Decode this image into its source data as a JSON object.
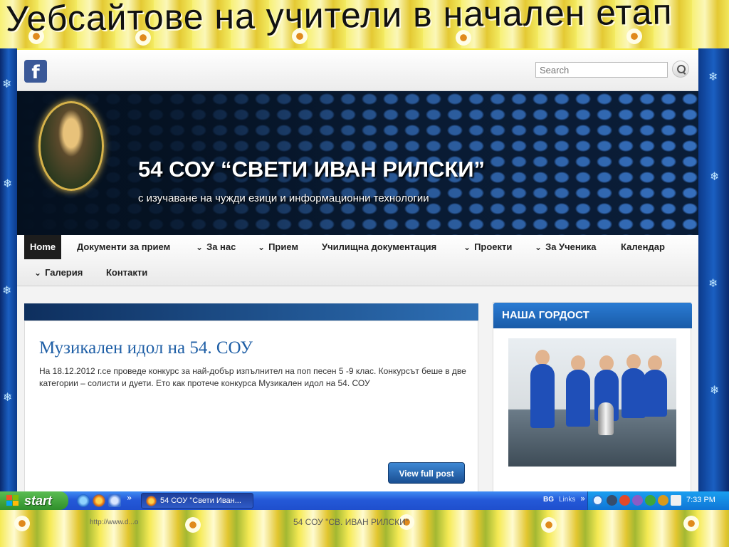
{
  "slide": {
    "title": "Уебсайтове на учители в начален етап",
    "footer_url": "http://www.d...o",
    "footer_text": "54 СОУ \"СВ. ИВАН РИЛСКИ\""
  },
  "browser_page": {
    "search": {
      "placeholder": "Search"
    },
    "header": {
      "school_name": "54 СОУ “СВЕТИ ИВАН РИЛСКИ”",
      "subtitle": "с изучаване на чужди езици и информационни технологии"
    },
    "nav": {
      "items": [
        {
          "label": "Home",
          "has_dropdown": false
        },
        {
          "label": "Документи за прием",
          "has_dropdown": false
        },
        {
          "label": "За нас",
          "has_dropdown": true
        },
        {
          "label": "Прием",
          "has_dropdown": true
        },
        {
          "label": "Училищна документация",
          "has_dropdown": false
        },
        {
          "label": "Проекти",
          "has_dropdown": true
        },
        {
          "label": "За Ученика",
          "has_dropdown": true
        },
        {
          "label": "Календар",
          "has_dropdown": false
        },
        {
          "label": "Галерия",
          "has_dropdown": true
        },
        {
          "label": "Контакти",
          "has_dropdown": false
        }
      ]
    },
    "post": {
      "title": "Музикален идол на 54. СОУ",
      "excerpt": "На 18.12.2012 г.се проведе  конкурс за най-добър изпълнител на поп песен 5 -9 клас. Конкурсът беше в две категории – солисти и дуети. Ето как протече конкурса       Музикален идол на 54. СОУ",
      "button_label": "View full post"
    },
    "sidebar": {
      "widget_title": "НАША ГОРДОСТ"
    }
  },
  "taskbar": {
    "start_label": "start",
    "window_title": "54 СОУ \"Свети Иван...",
    "language": "BG",
    "links_label": "Links",
    "links_chevron": "»",
    "quicklaunch_chevron": "»",
    "clock": "7:33 PM"
  },
  "colors": {
    "slide_background": "#f2e23a",
    "taskbar_blue": "#2459d8",
    "start_green": "#3a9b35",
    "widget_blue": "#2a7bd3",
    "post_title_blue": "#1f5fa6",
    "nav_active": "#1d1d1d"
  },
  "icons": {
    "facebook": "facebook-icon",
    "search": "search-icon",
    "dropdown": "chevron-down-icon",
    "windows": "windows-logo-icon",
    "browser": "firefox-icon"
  }
}
